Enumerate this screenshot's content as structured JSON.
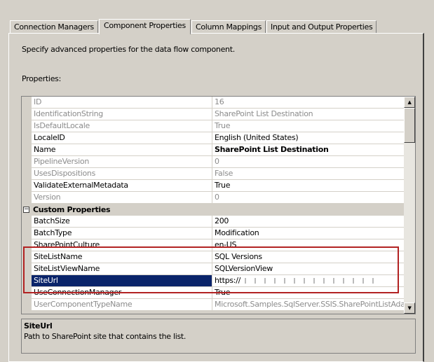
{
  "tabs": [
    "Connection Managers",
    "Component Properties",
    "Column Mappings",
    "Input and Output Properties"
  ],
  "description": "Specify advanced properties for the data flow component.",
  "properties_label": "Properties:",
  "rows": [
    {
      "name": "ID",
      "value": "16",
      "readonly": true
    },
    {
      "name": "IdentificationString",
      "value": "SharePoint List Destination",
      "readonly": true
    },
    {
      "name": "IsDefaultLocale",
      "value": "True",
      "readonly": true
    },
    {
      "name": "LocaleID",
      "value": "English (United States)",
      "readonly": false
    },
    {
      "name": "Name",
      "value": "SharePoint List Destination",
      "readonly": false,
      "bold": true
    },
    {
      "name": "PipelineVersion",
      "value": "0",
      "readonly": true
    },
    {
      "name": "UsesDispositions",
      "value": "False",
      "readonly": true
    },
    {
      "name": "ValidateExternalMetadata",
      "value": "True",
      "readonly": false
    },
    {
      "name": "Version",
      "value": "0",
      "readonly": true
    }
  ],
  "category": {
    "label": "Custom Properties",
    "toggle": "−"
  },
  "custom_rows": [
    {
      "name": "BatchSize",
      "value": "200",
      "readonly": false
    },
    {
      "name": "BatchType",
      "value": "Modification",
      "readonly": false
    },
    {
      "name": "SharePointCulture",
      "value": "en-US",
      "readonly": false
    },
    {
      "name": "SiteListName",
      "value": "SQL Versions",
      "readonly": false
    },
    {
      "name": "SiteListViewName",
      "value": "SQLVersionView",
      "readonly": false
    },
    {
      "name": "SiteUrl",
      "value": "https://",
      "readonly": false,
      "selected": true
    },
    {
      "name": "UseConnectionManager",
      "value": "True",
      "readonly": false
    },
    {
      "name": "UserComponentTypeName",
      "value": "Microsoft.Samples.SqlServer.SSIS.SharePointListAdapters",
      "readonly": true
    }
  ],
  "help": {
    "title": "SiteUrl",
    "text": "Path to SharePoint site that contains the list."
  },
  "colors": {
    "selection": "#0a246a",
    "highlight_box": "#b22222"
  }
}
